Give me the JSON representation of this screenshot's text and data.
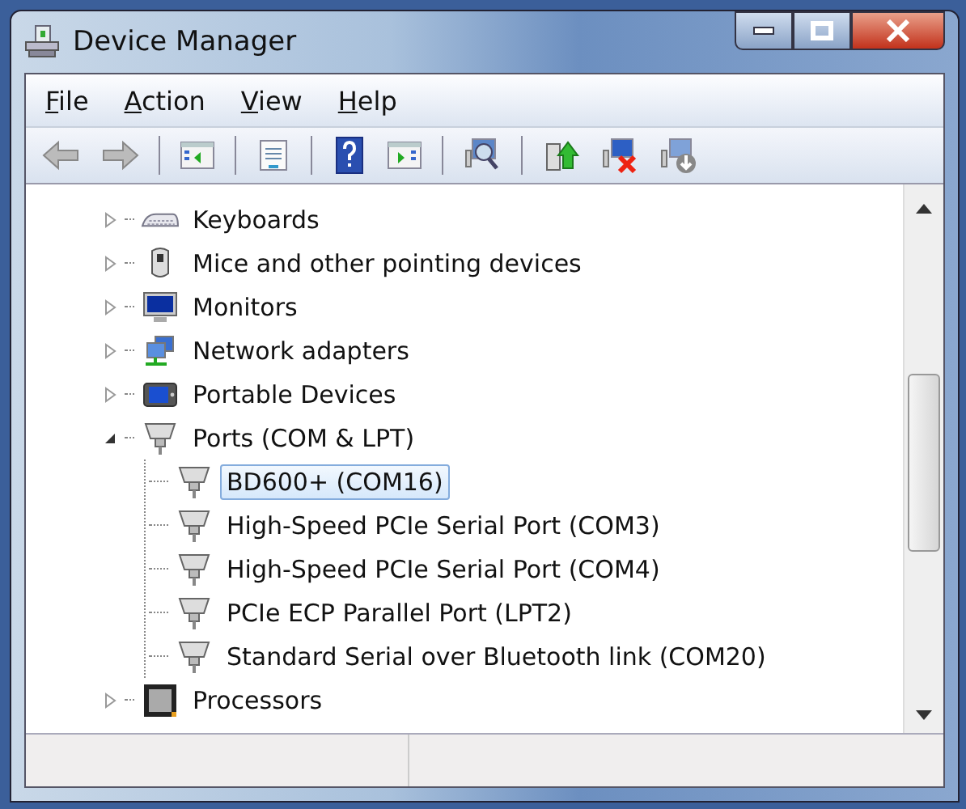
{
  "window": {
    "title": "Device Manager"
  },
  "menu": [
    {
      "label": "File"
    },
    {
      "label": "Action"
    },
    {
      "label": "View"
    },
    {
      "label": "Help"
    }
  ],
  "tree": [
    {
      "label": "Keyboards",
      "kind": "keyboard",
      "expanded": false,
      "selected": false
    },
    {
      "label": "Mice and other pointing devices",
      "kind": "mouse",
      "expanded": false,
      "selected": false
    },
    {
      "label": "Monitors",
      "kind": "monitor",
      "expanded": false,
      "selected": false
    },
    {
      "label": "Network adapters",
      "kind": "network",
      "expanded": false,
      "selected": false
    },
    {
      "label": "Portable Devices",
      "kind": "portable",
      "expanded": false,
      "selected": false
    },
    {
      "label": "Ports (COM & LPT)",
      "kind": "port",
      "expanded": true,
      "selected": false,
      "children": [
        {
          "label": "BD600+ (COM16)",
          "kind": "port",
          "selected": true
        },
        {
          "label": "High-Speed PCIe Serial Port (COM3)",
          "kind": "port",
          "selected": false
        },
        {
          "label": "High-Speed PCIe Serial Port (COM4)",
          "kind": "port",
          "selected": false
        },
        {
          "label": "PCIe ECP Parallel Port (LPT2)",
          "kind": "port",
          "selected": false
        },
        {
          "label": "Standard Serial over Bluetooth link (COM20)",
          "kind": "port",
          "selected": false
        }
      ]
    },
    {
      "label": "Processors",
      "kind": "processor",
      "expanded": false,
      "selected": false
    }
  ]
}
